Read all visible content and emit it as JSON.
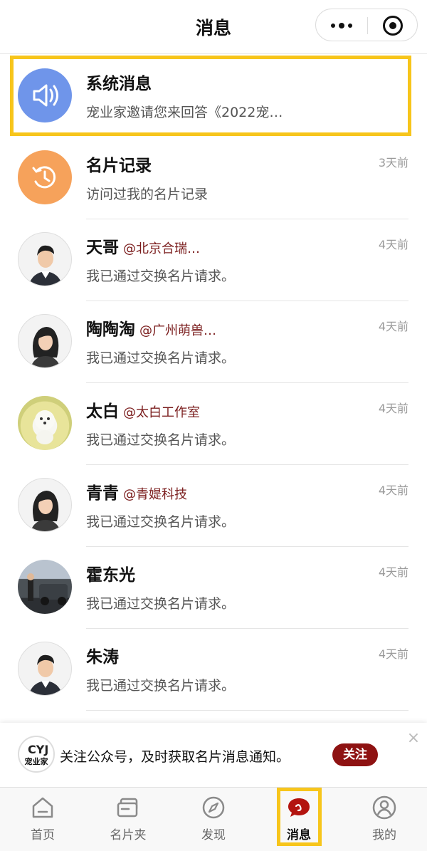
{
  "header": {
    "title": "消息"
  },
  "messages": [
    {
      "name": "系统消息",
      "company": "",
      "preview": "宠业家邀请您来回答《2022宠…",
      "time": "",
      "avatar": "speaker-icon"
    },
    {
      "name": "名片记录",
      "company": "",
      "preview": "访问过我的名片记录",
      "time": "3天前",
      "avatar": "history-icon"
    },
    {
      "name": "天哥",
      "company": "@北京合瑞…",
      "preview": "我已通过交换名片请求。",
      "time": "4天前",
      "avatar": "man-avatar"
    },
    {
      "name": "陶陶淘",
      "company": "@广州萌兽…",
      "preview": "我已通过交换名片请求。",
      "time": "4天前",
      "avatar": "woman-avatar"
    },
    {
      "name": "太白",
      "company": "@太白工作室",
      "preview": "我已通过交换名片请求。",
      "time": "4天前",
      "avatar": "dog-photo"
    },
    {
      "name": "青青",
      "company": "@青媞科技",
      "preview": "我已通过交换名片请求。",
      "time": "4天前",
      "avatar": "woman-avatar"
    },
    {
      "name": "霍东光",
      "company": "",
      "preview": "我已通过交换名片请求。",
      "time": "4天前",
      "avatar": "car-photo"
    },
    {
      "name": "朱涛",
      "company": "",
      "preview": "我已通过交换名片请求。",
      "time": "4天前",
      "avatar": "man-avatar"
    }
  ],
  "banner": {
    "logo_text": "宠业家",
    "logo_mark": "CYJ",
    "text": "关注公众号，及时获取名片消息通知。",
    "follow_label": "关注",
    "close_glyph": "×"
  },
  "tabbar": {
    "tabs": [
      {
        "label": "首页",
        "icon": "home-icon"
      },
      {
        "label": "名片夹",
        "icon": "card-holder-icon"
      },
      {
        "label": "发现",
        "icon": "compass-icon"
      },
      {
        "label": "消息",
        "icon": "chat-bubble-icon",
        "active": true
      },
      {
        "label": "我的",
        "icon": "profile-icon"
      }
    ]
  },
  "colors": {
    "highlight": "#f7c51b",
    "accent": "#8e1212",
    "company_text": "#7a1c1c",
    "system_avatar": "#6f95ea",
    "record_avatar": "#f6a25b"
  }
}
